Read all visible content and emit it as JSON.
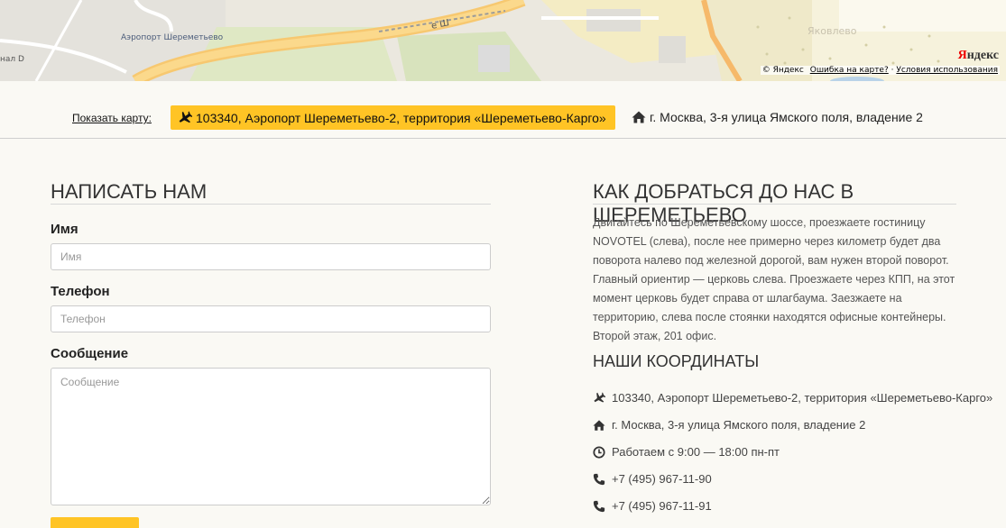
{
  "map": {
    "airport_label": "Аэропорт Шереметьево",
    "canal_label": "нал D",
    "street_label": "е Ш",
    "village_label": "Яковлево",
    "logo_first": "Я",
    "logo_rest": "ндекс",
    "copyright": "© Яндекс",
    "error_link": "Ошибка на карте?",
    "separator": "·",
    "terms_link": "Условия использования"
  },
  "address_bar": {
    "show_map_label": "Показать карту:",
    "airport_address": "103340, Аэропорт Шереметьево-2, территория «Шереметьево-Карго»",
    "city_address": "г. Москва, 3-я улица Ямского поля, владение 2"
  },
  "form": {
    "title": "НАПИСАТЬ НАМ",
    "name_label": "Имя",
    "name_placeholder": "Имя",
    "phone_label": "Телефон",
    "phone_placeholder": "Телефон",
    "message_label": "Сообщение",
    "message_placeholder": "Сообщение"
  },
  "directions": {
    "title": "КАК ДОБРАТЬСЯ ДО НАС В ШЕРЕМЕТЬЕВО",
    "text": "Двигайтесь по Шереметьевскому шоссе, проезжаете гостиницу NOVOTEL (слева), после нее примерно через километр будет два поворота налево под железной дорогой, вам нужен второй поворот. Главный ориентир — церковь слева. Проезжаете через КПП, на этот момент церковь будет справа от шлагбаума. Заезжаете на территорию, слева после стоянки находятся офисные контейнеры. Второй этаж, 201 офис."
  },
  "coordinates": {
    "title": "НАШИ КООРДИНАТЫ",
    "airport": "103340, Аэропорт Шереметьево-2, территория «Шереметьево-Карго»",
    "city": "г. Москва, 3-я улица Ямского поля, владение 2",
    "hours": "Работаем с 9:00 — 18:00 пн-пт",
    "phone1": "+7 (495) 967-11-90",
    "phone2": "+7 (495) 967-11-91"
  },
  "colors": {
    "accent": "#ffc425",
    "background": "#faf9f4",
    "map_yandex_red": "#ee0000"
  },
  "icons": [
    "plane-icon",
    "home-icon",
    "clock-icon",
    "phone-icon"
  ]
}
